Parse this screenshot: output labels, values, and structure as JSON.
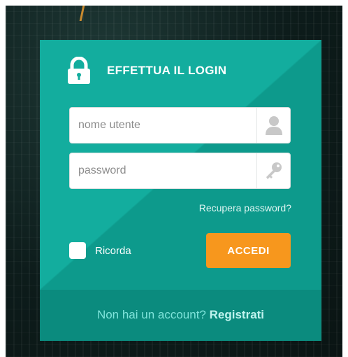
{
  "login": {
    "title": "EFFETTUA IL LOGIN",
    "username_placeholder": "nome utente",
    "password_placeholder": "password",
    "recover_label": "Recupera password?",
    "remember_label": "Ricorda",
    "submit_label": "ACCEDI"
  },
  "footer": {
    "prompt": "Non hai un account?",
    "register_label": "Registrati"
  },
  "colors": {
    "panel": "#13ad9e",
    "panel_dark": "#0d9a8c",
    "footer": "#0b8b7e",
    "accent_button": "#f7971d"
  },
  "icons": {
    "lock": "lock-icon",
    "user": "user-icon",
    "key": "key-icon"
  }
}
